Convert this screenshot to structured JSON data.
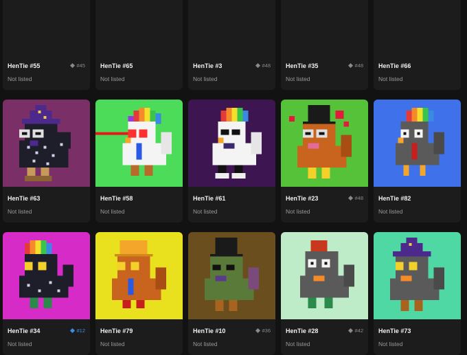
{
  "cards": [
    {
      "name": "HenTie #55",
      "rank": "#45",
      "status": "Not listed",
      "bg": "#1c1c1c"
    },
    {
      "name": "HenTie #65",
      "rank": "",
      "status": "Not listed",
      "bg": "#1c1c1c"
    },
    {
      "name": "HenTie #3",
      "rank": "#48",
      "status": "Not listed",
      "bg": "#1c1c1c"
    },
    {
      "name": "HenTie #35",
      "rank": "#48",
      "status": "Not listed",
      "bg": "#1c1c1c"
    },
    {
      "name": "HenTie #66",
      "rank": "",
      "status": "Not listed",
      "bg": "#1c1c1c"
    },
    {
      "name": "HenTie #63",
      "rank": "",
      "status": "Not listed",
      "bg": "#7a2f66"
    },
    {
      "name": "HenTie #58",
      "rank": "",
      "status": "Not listed",
      "bg": "#4ddb5a"
    },
    {
      "name": "HenTie #61",
      "rank": "",
      "status": "Not listed",
      "bg": "#3d1550"
    },
    {
      "name": "HenTie #23",
      "rank": "#48",
      "status": "Not listed",
      "bg": "#56c23a"
    },
    {
      "name": "HenTie #82",
      "rank": "",
      "status": "Not listed",
      "bg": "#3f72ea"
    },
    {
      "name": "HenTie #34",
      "rank": "#12",
      "status": "Not listed",
      "bg": "#d62bc6",
      "rank_blue": true
    },
    {
      "name": "HenTie #79",
      "rank": "",
      "status": "Not listed",
      "bg": "#e9e01e"
    },
    {
      "name": "HenTie #10",
      "rank": "#36",
      "status": "Not listed",
      "bg": "#6b4e1e"
    },
    {
      "name": "HenTie #28",
      "rank": "#42",
      "status": "Not listed",
      "bg": "#bfecc8"
    },
    {
      "name": "HenTie #73",
      "rank": "",
      "status": "Not listed",
      "bg": "#4fd7a4"
    }
  ],
  "icons": {
    "rank": "diamond-icon"
  }
}
